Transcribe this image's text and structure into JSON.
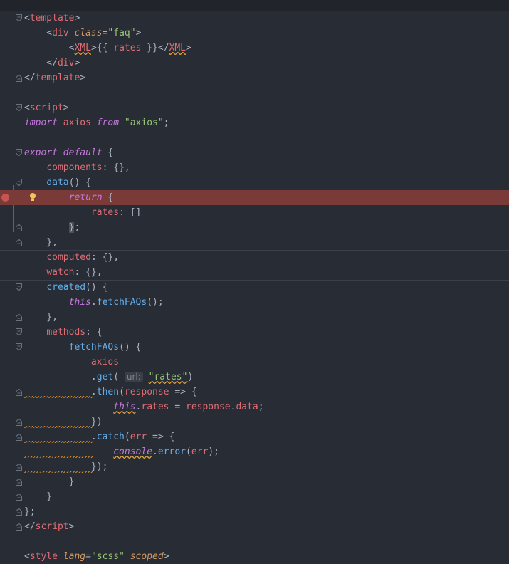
{
  "editor": {
    "lines": [
      [
        [
          "punc",
          "<"
        ],
        [
          "tag",
          "template"
        ],
        [
          "punc",
          ">"
        ]
      ],
      [
        [
          "punc",
          "    <"
        ],
        [
          "tag",
          "div"
        ],
        [
          "punc",
          " "
        ],
        [
          "attr",
          "class"
        ],
        [
          "punc",
          "="
        ],
        [
          "str",
          "\"faq\""
        ],
        [
          "punc",
          ">"
        ]
      ],
      [
        [
          "punc",
          "        <"
        ],
        [
          "tagsq",
          "XML"
        ],
        [
          "punc",
          ">{{ "
        ],
        [
          "prop",
          "rates"
        ],
        [
          "punc",
          " }}</"
        ],
        [
          "tagsq",
          "XML"
        ],
        [
          "punc",
          ">"
        ]
      ],
      [
        [
          "punc",
          "    </"
        ],
        [
          "tag",
          "div"
        ],
        [
          "punc",
          ">"
        ]
      ],
      [
        [
          "punc",
          "</"
        ],
        [
          "tag",
          "template"
        ],
        [
          "punc",
          ">"
        ]
      ],
      [],
      [
        [
          "punc",
          "<"
        ],
        [
          "tag",
          "script"
        ],
        [
          "punc",
          ">"
        ]
      ],
      [
        [
          "kw",
          "import"
        ],
        [
          "punc",
          " "
        ],
        [
          "id",
          "axios"
        ],
        [
          "punc",
          " "
        ],
        [
          "kw",
          "from"
        ],
        [
          "punc",
          " "
        ],
        [
          "str",
          "\"axios\""
        ],
        [
          "punc",
          ";"
        ]
      ],
      [],
      [
        [
          "kw",
          "export"
        ],
        [
          "punc",
          " "
        ],
        [
          "kw",
          "default"
        ],
        [
          "punc",
          " {"
        ]
      ],
      [
        [
          "punc",
          "    "
        ],
        [
          "prop",
          "components"
        ],
        [
          "punc",
          ": {},"
        ]
      ],
      [
        [
          "punc",
          "    "
        ],
        [
          "fn",
          "data"
        ],
        [
          "punc",
          "() {"
        ]
      ],
      [
        [
          "punc",
          "        "
        ],
        [
          "kw",
          "return"
        ],
        [
          "punc",
          " {"
        ]
      ],
      [
        [
          "punc",
          "            "
        ],
        [
          "prop",
          "rates"
        ],
        [
          "punc",
          ": []"
        ]
      ],
      [
        [
          "punc",
          "        "
        ],
        [
          "sel",
          "}"
        ],
        [
          "punc",
          ";"
        ]
      ],
      [
        [
          "punc",
          "    },"
        ]
      ],
      [
        [
          "punc",
          "    "
        ],
        [
          "prop",
          "computed"
        ],
        [
          "punc",
          ": {},"
        ]
      ],
      [
        [
          "punc",
          "    "
        ],
        [
          "prop",
          "watch"
        ],
        [
          "punc",
          ": {},"
        ]
      ],
      [
        [
          "punc",
          "    "
        ],
        [
          "fn",
          "created"
        ],
        [
          "punc",
          "() {"
        ]
      ],
      [
        [
          "punc",
          "        "
        ],
        [
          "this",
          "this"
        ],
        [
          "punc",
          "."
        ],
        [
          "fn",
          "fetchFAQs"
        ],
        [
          "punc",
          "();"
        ]
      ],
      [
        [
          "punc",
          "    },"
        ]
      ],
      [
        [
          "punc",
          "    "
        ],
        [
          "prop",
          "methods"
        ],
        [
          "punc",
          ": {"
        ]
      ],
      [
        [
          "punc",
          "        "
        ],
        [
          "fn",
          "fetchFAQs"
        ],
        [
          "punc",
          "() {"
        ]
      ],
      [
        [
          "punc",
          "            "
        ],
        [
          "id",
          "axios"
        ]
      ],
      [
        [
          "punc",
          "            ."
        ],
        [
          "fn",
          "get"
        ],
        [
          "punc",
          "( "
        ],
        [
          "hint",
          "url:"
        ],
        [
          "punc",
          " "
        ],
        [
          "strsq",
          "\"rates\""
        ],
        [
          "punc",
          ")"
        ]
      ],
      [
        [
          "punc",
          "            ."
        ],
        [
          "fn",
          "then"
        ],
        [
          "punc",
          "("
        ],
        [
          "id",
          "response"
        ],
        [
          "punc",
          " => {"
        ]
      ],
      [
        [
          "punc",
          "                "
        ],
        [
          "thissq",
          "this"
        ],
        [
          "punc",
          "."
        ],
        [
          "prop",
          "rates"
        ],
        [
          "punc",
          " = "
        ],
        [
          "id",
          "response"
        ],
        [
          "punc",
          "."
        ],
        [
          "prop",
          "data"
        ],
        [
          "punc",
          ";"
        ]
      ],
      [
        [
          "punc",
          "            })"
        ]
      ],
      [
        [
          "punc",
          "            ."
        ],
        [
          "fn",
          "catch"
        ],
        [
          "punc",
          "("
        ],
        [
          "id",
          "err"
        ],
        [
          "punc",
          " => {"
        ]
      ],
      [
        [
          "punc",
          "                "
        ],
        [
          "kwsq",
          "console"
        ],
        [
          "punc",
          "."
        ],
        [
          "fn",
          "error"
        ],
        [
          "punc",
          "("
        ],
        [
          "id",
          "err"
        ],
        [
          "punc",
          ");"
        ]
      ],
      [
        [
          "punc",
          "            });"
        ]
      ],
      [
        [
          "punc",
          "        }"
        ]
      ],
      [
        [
          "punc",
          "    }"
        ]
      ],
      [
        [
          "punc",
          "};"
        ]
      ],
      [
        [
          "punc",
          "</"
        ],
        [
          "tag",
          "script"
        ],
        [
          "punc",
          ">"
        ]
      ],
      [],
      [
        [
          "punc",
          "<"
        ],
        [
          "tag",
          "style"
        ],
        [
          "punc",
          " "
        ],
        [
          "attr",
          "lang"
        ],
        [
          "punc",
          "="
        ],
        [
          "str",
          "\"scss\""
        ],
        [
          "punc",
          " "
        ],
        [
          "attr",
          "scoped"
        ],
        [
          "punc",
          ">"
        ]
      ]
    ]
  }
}
